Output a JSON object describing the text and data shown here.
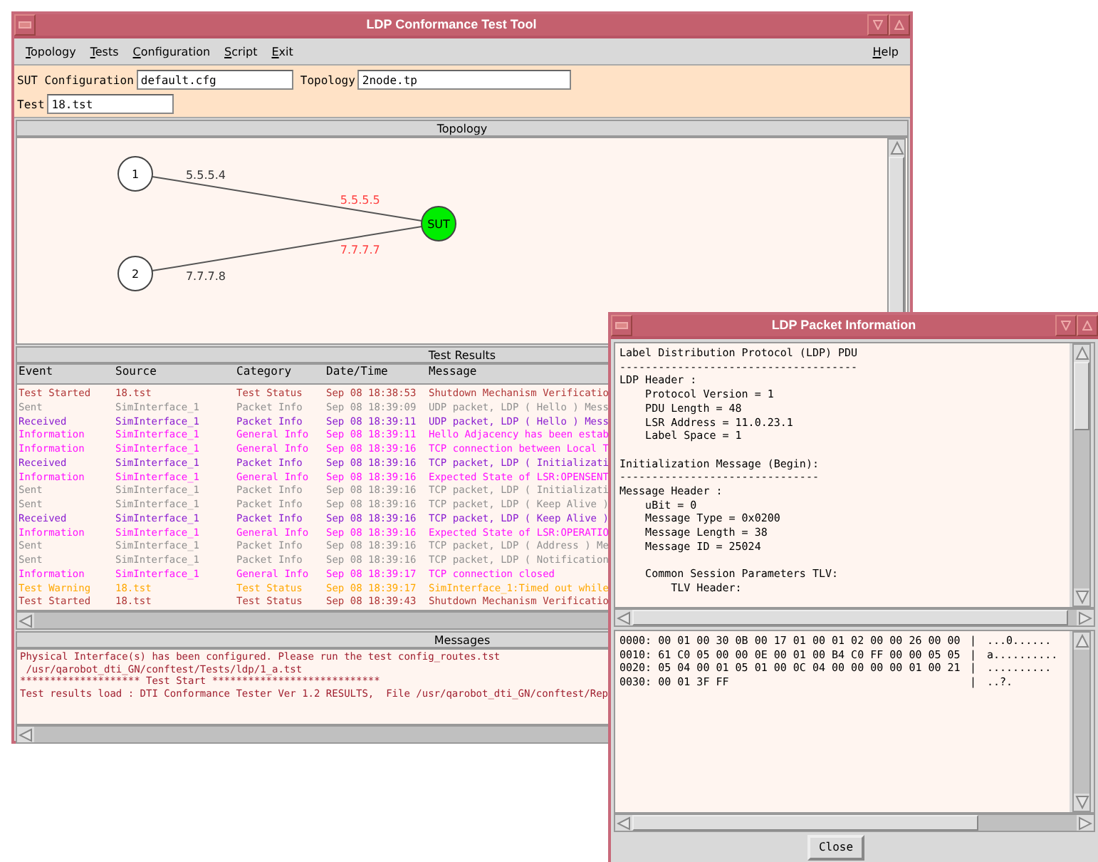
{
  "main_window": {
    "title": "LDP Conformance Test Tool"
  },
  "menu": [
    {
      "label": "Topology"
    },
    {
      "label": "Tests"
    },
    {
      "label": "Configuration"
    },
    {
      "label": "Script"
    },
    {
      "label": "Exit"
    }
  ],
  "help_menu": {
    "label": "Help"
  },
  "config": {
    "sut_label": "SUT Configuration",
    "sut_value": "default.cfg",
    "topology_label": "Topology",
    "topology_value": "2node.tp",
    "test_label": "Test",
    "test_value": "18.tst"
  },
  "topology": {
    "header": "Topology",
    "nodes": [
      {
        "label": "1",
        "kind": "router"
      },
      {
        "label": "2",
        "kind": "router"
      },
      {
        "label": "SUT",
        "kind": "sut"
      }
    ],
    "links": [
      {
        "near_address": "5.5.5.4",
        "far_address": "5.5.5.5"
      },
      {
        "near_address": "7.7.7.8",
        "far_address": "7.7.7.7"
      }
    ]
  },
  "test_results": {
    "header": "Test Results",
    "columns": [
      "Event",
      "Source",
      "Category",
      "Date/Time",
      "Message"
    ],
    "rows": [
      {
        "event": "Test Started",
        "source": "18.tst",
        "category": "Test Status",
        "date_time": "Sep 08 18:38:53",
        "message": "Shutdown Mechanism Verificatio",
        "color": "#b03838"
      },
      {
        "event": "Sent",
        "source": "SimInterface_1",
        "category": "Packet Info",
        "date_time": "Sep 08 18:39:09",
        "message": "UDP packet, LDP ( Hello ) Mess",
        "color": "#909090"
      },
      {
        "event": "Received",
        "source": "SimInterface_1",
        "category": "Packet Info",
        "date_time": "Sep 08 18:39:11",
        "message": "UDP packet, LDP ( Hello ) Mess",
        "color": "#8a1cd0"
      },
      {
        "event": "Information",
        "source": "SimInterface_1",
        "category": "General Info",
        "date_time": "Sep 08 18:39:11",
        "message": "Hello Adjacency has been estab",
        "color": "#ff10ff"
      },
      {
        "event": "Information",
        "source": "SimInterface_1",
        "category": "General Info",
        "date_time": "Sep 08 18:39:16",
        "message": "TCP connection between Local T",
        "color": "#ff10ff"
      },
      {
        "event": "Received",
        "source": "SimInterface_1",
        "category": "Packet Info",
        "date_time": "Sep 08 18:39:16",
        "message": "TCP packet, LDP ( Initializati",
        "color": "#8a1cd0"
      },
      {
        "event": "Information",
        "source": "SimInterface_1",
        "category": "General Info",
        "date_time": "Sep 08 18:39:16",
        "message": "Expected State of LSR:OPENSENT",
        "color": "#ff10ff"
      },
      {
        "event": "Sent",
        "source": "SimInterface_1",
        "category": "Packet Info",
        "date_time": "Sep 08 18:39:16",
        "message": "TCP packet, LDP ( Initializati",
        "color": "#909090"
      },
      {
        "event": "Sent",
        "source": "SimInterface_1",
        "category": "Packet Info",
        "date_time": "Sep 08 18:39:16",
        "message": "TCP packet, LDP ( Keep Alive )",
        "color": "#909090"
      },
      {
        "event": "Received",
        "source": "SimInterface_1",
        "category": "Packet Info",
        "date_time": "Sep 08 18:39:16",
        "message": "TCP packet, LDP ( Keep Alive )",
        "color": "#8a1cd0"
      },
      {
        "event": "Information",
        "source": "SimInterface_1",
        "category": "General Info",
        "date_time": "Sep 08 18:39:16",
        "message": "Expected State of LSR:OPERATIO",
        "color": "#ff10ff"
      },
      {
        "event": "Sent",
        "source": "SimInterface_1",
        "category": "Packet Info",
        "date_time": "Sep 08 18:39:16",
        "message": "TCP packet, LDP ( Address ) Me",
        "color": "#909090"
      },
      {
        "event": "Sent",
        "source": "SimInterface_1",
        "category": "Packet Info",
        "date_time": "Sep 08 18:39:16",
        "message": "TCP packet, LDP ( Notification",
        "color": "#909090"
      },
      {
        "event": "Information",
        "source": "SimInterface_1",
        "category": "General Info",
        "date_time": "Sep 08 18:39:17",
        "message": "TCP connection closed",
        "color": "#ff10ff"
      },
      {
        "event": "Test Warning",
        "source": "18.tst",
        "category": "Test Status",
        "date_time": "Sep 08 18:39:17",
        "message": "SimInterface_1:Timed out while",
        "color": "#ffa800"
      },
      {
        "event": "Test Started",
        "source": "18.tst",
        "category": "Test Status",
        "date_time": "Sep 08 18:39:43",
        "message": "Shutdown Mechanism Verificatio",
        "color": "#b03838"
      }
    ]
  },
  "messages": {
    "header": "Messages",
    "lines": [
      "Physical Interface(s) has been configured. Please run the test config_routes.tst",
      " /usr/qarobot_dti_GN/conftest/Tests/ldp/1_a.tst",
      "******************** Test Start ****************************",
      "Test results load : DTI Conformance Tester Ver 1.2 RESULTS,  File /usr/qarobot_dti_GN/conftest/Rep"
    ]
  },
  "packet_window": {
    "title": "LDP Packet Information",
    "decode_blocks": [
      [
        "Label Distribution Protocol (LDP) PDU",
        "-------------------------------------",
        "LDP Header :",
        "    Protocol Version = 1",
        "    PDU Length = 48",
        "    LSR Address = 11.0.23.1",
        "    Label Space = 1"
      ],
      [
        "Initialization Message (Begin):",
        "-------------------------------",
        "Message Header :",
        "    uBit = 0",
        "    Message Type = 0x0200",
        "    Message Length = 38",
        "    Message ID = 25024"
      ],
      [
        "    Common Session Parameters TLV:",
        "        TLV Header:"
      ]
    ],
    "hex_rows": [
      {
        "hex": "0000: 00 01 00 30 0B 00 17 01 00 01 02 00 00 26 00 00",
        "separator": "|",
        "ascii": "...0......"
      },
      {
        "hex": "0010: 61 C0 05 00 00 0E 00 01 00 B4 C0 FF 00 00 05 05",
        "separator": "|",
        "ascii": "a.........."
      },
      {
        "hex": "0020: 05 04 00 01 05 01 00 0C 04 00 00 00 00 01 00 21",
        "separator": "|",
        "ascii": ".........."
      },
      {
        "hex": "0030: 00 01 3F FF",
        "separator": "|",
        "ascii": "..?."
      }
    ],
    "close_button": "Close"
  }
}
